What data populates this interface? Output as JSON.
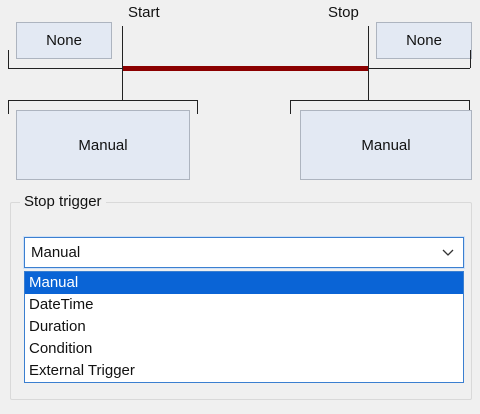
{
  "timeline": {
    "start_label": "Start",
    "stop_label": "Stop",
    "left_button": "None",
    "right_button": "None",
    "left_trigger_button": "Manual",
    "right_trigger_button": "Manual",
    "active_bar_color": "#8b0000"
  },
  "stop_trigger": {
    "group_title": "Stop trigger",
    "selected_value": "Manual",
    "options": [
      "Manual",
      "DateTime",
      "Duration",
      "Condition",
      "External Trigger"
    ],
    "highlighted_index": 0
  }
}
